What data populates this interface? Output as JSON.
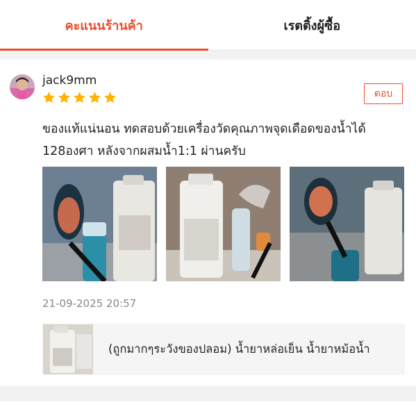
{
  "tabs": [
    {
      "label": "คะแนนร้านค้า",
      "active": true
    },
    {
      "label": "เรตติ้งผู้ซื้อ",
      "active": false
    }
  ],
  "review": {
    "username": "jack9mm",
    "rating": 5,
    "reply_label": "ตอบ",
    "text": "ของแท้แน่นอน ทดสอบด้วยเครื่องวัดคุณภาพจุดเดือดของน้ำได้ 128องศา หลังจากผสมน้ำ1:1 ผ่านครับ",
    "timestamp": "21-09-2025 20:57",
    "photo_count": 3
  },
  "product": {
    "name": "(ถูกมากๆระวังของปลอม) น้ำยาหล่อเย็น น้ำยาหม้อน้ำ"
  },
  "colors": {
    "accent": "#ee4d2d",
    "star": "#ffb400",
    "muted_text": "#888888"
  }
}
